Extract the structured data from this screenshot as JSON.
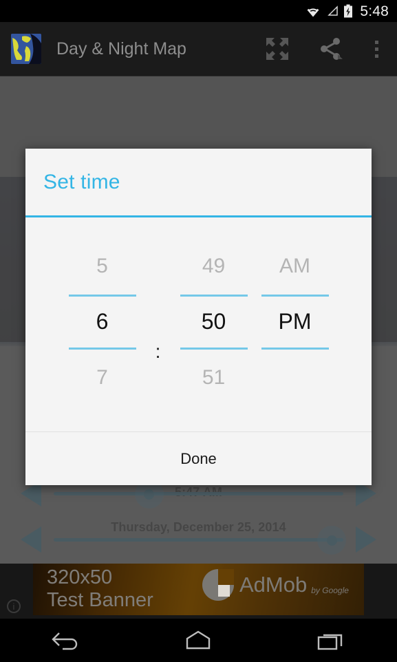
{
  "statusbar": {
    "time": "5:48",
    "icons": [
      "wifi-icon",
      "signal-icon",
      "battery-charging-icon"
    ]
  },
  "actionbar": {
    "app_icon": "world-map-icon",
    "title": "Day & Night Map",
    "actions": [
      {
        "name": "fullscreen-icon",
        "label": "Fullscreen"
      },
      {
        "name": "share-icon",
        "label": "Share"
      },
      {
        "name": "overflow-menu-icon",
        "label": "More options"
      }
    ]
  },
  "app": {
    "time_label": "5:47 AM",
    "date_label": "Thursday, December 25, 2014",
    "time_slider": {
      "value_pct": 33,
      "left_arrow": "arrow-left-icon",
      "right_arrow": "arrow-right-icon"
    },
    "date_slider": {
      "value_pct": 96,
      "left_arrow": "arrow-left-icon",
      "right_arrow": "arrow-right-icon"
    }
  },
  "dialog": {
    "title": "Set time",
    "done_label": "Done",
    "picker": {
      "hour": {
        "previous": "5",
        "current": "6",
        "next": "7"
      },
      "separator": ":",
      "minute": {
        "previous": "49",
        "current": "50",
        "next": "51"
      },
      "meridiem": {
        "previous": "AM",
        "current": "PM",
        "next": ""
      }
    }
  },
  "ad": {
    "line1": "320x50",
    "line2": "Test Banner",
    "brand": "AdMob",
    "by": "by Google",
    "info_glyph": "i"
  },
  "navbar": {
    "keys": [
      {
        "name": "back-icon",
        "label": "Back"
      },
      {
        "name": "home-icon",
        "label": "Home"
      },
      {
        "name": "recents-icon",
        "label": "Recent apps"
      }
    ]
  },
  "colors": {
    "accent": "#33b5e5",
    "picker_divider": "#74c8e8",
    "slider": "#1d5d78",
    "dialog_bg": "#f4f4f4",
    "actionbar_bg": "#1b1b1b"
  }
}
